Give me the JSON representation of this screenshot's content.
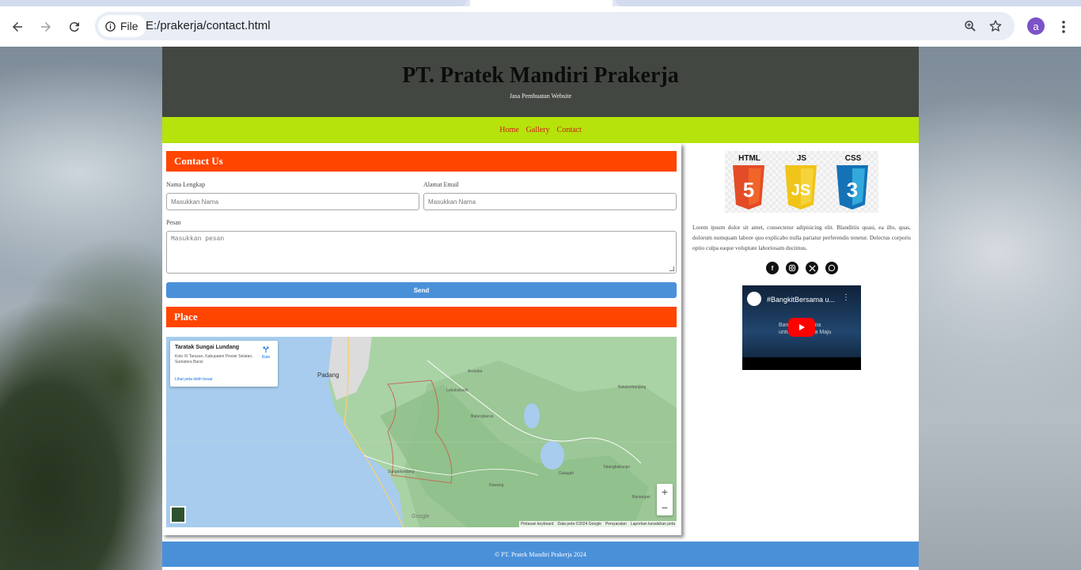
{
  "browser": {
    "site_chip": "File",
    "url": "E:/prakerja/contact.html",
    "profile_initial": "a"
  },
  "site": {
    "title": "PT. Pratek Mandiri Prakerja",
    "tagline": "Jasa Pembuatan Website",
    "nav": [
      "Home",
      "Gallery",
      "Contact"
    ],
    "footer": "© PT. Pratek Mandiri Prakerja 2024"
  },
  "contact": {
    "heading": "Contact Us",
    "name_label": "Nama Lengkap",
    "name_placeholder": "Masukkan Nama",
    "email_label": "Alamat Email",
    "email_placeholder": "Masukkan Nama",
    "message_label": "Pesan",
    "message_placeholder": "Masukkan pesan",
    "send_label": "Send"
  },
  "place": {
    "heading": "Place",
    "map_card": {
      "name": "Taratak Sungai Lundang",
      "address": "Koto XI Tarusan, Kabupaten Pesisir Selatan, Sumatera Barat",
      "directions": "Rute",
      "larger_map": "Lihat peta lebih besar"
    },
    "map_labels": {
      "padang": "Padang",
      "sungai_lundang": "Sungailundang",
      "batang_barus": "Batangbarus",
      "alahan_panjang": "Lubuksilasih",
      "gatagah": "Gatagah",
      "rawang": "Rawang",
      "talang_babungo": "Talangbabungo",
      "batuberanjang": "Batuberbanjang",
      "arosuka": "Arosuka",
      "bariangan": "Bariangan"
    },
    "map_footer": [
      "Pintasan keyboard",
      "Data peta ©2024 Google",
      "Persyaratan",
      "Laporkan kesalahan peta"
    ],
    "map_logo": "Google",
    "zoom_in": "+",
    "zoom_out": "−"
  },
  "sidebar": {
    "tech_badges": [
      "HTML",
      "JS",
      "CSS"
    ],
    "lorem": "Lorem ipsum dolor sit amet, consectetur adipisicing elit. Blanditiis quasi, ea illo, quas, dolorum numquam labore quo explicabo nulla pariatur perferendis tenetur. Delectus corporis optio culpa eaque voluptate laboriosam ducimus.",
    "socials": [
      "facebook-icon",
      "instagram-icon",
      "x-icon",
      "whatsapp-icon"
    ],
    "video": {
      "title": "#BangkitBersama u...",
      "overlay": "Bangkit Bersama untuk Indonesia Maju"
    }
  },
  "colors": {
    "header_bg": "#434741",
    "nav_bg": "#b5e30b",
    "nav_link": "#d21c1c",
    "section_head": "#ff4500",
    "send_button": "#4a90d9",
    "footer_bg": "#4a90d9"
  }
}
